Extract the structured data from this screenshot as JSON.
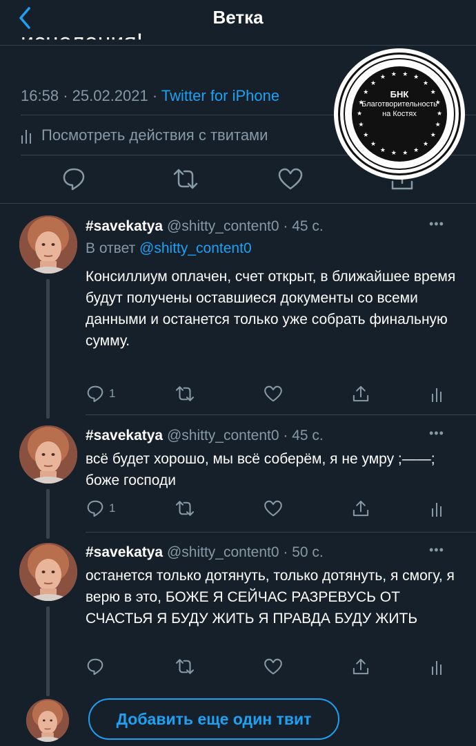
{
  "header": {
    "title": "Ветка",
    "cut_text": "исцеления!"
  },
  "main_tweet": {
    "time": "16:58",
    "date": "25.02.2021",
    "source": "Twitter for iPhone",
    "activity_label": "Посмотреть действия с твитами"
  },
  "stamp": {
    "line1": "БНК",
    "line2": "Благотворительность",
    "line3": "на Костях"
  },
  "replies": [
    {
      "name": "#savekatya",
      "handle": "@shitty_content0",
      "time": "45 с.",
      "reply_prefix": "В ответ",
      "reply_to": "@shitty_content0",
      "text": "Консиллиум оплачен, счет открыт, в ближайшее время будут получены оставшиеся документы со всеми данными и останется только уже собрать финальную сумму.",
      "reply_count": "1"
    },
    {
      "name": "#savekatya",
      "handle": "@shitty_content0",
      "time": "45 с.",
      "text": "всё будет хорошо, мы всё соберём, я не умру ;——; боже господи",
      "reply_count": "1"
    },
    {
      "name": "#savekatya",
      "handle": "@shitty_content0",
      "time": "50 с.",
      "text": "останется только дотянуть, только дотянуть, я смогу, я верю в это, БОЖЕ Я СЕЙЧАС РАЗРЕВУСЬ ОТ СЧАСТЬЯ Я БУДУ ЖИТЬ Я ПРАВДА БУДУ ЖИТЬ",
      "reply_count": ""
    }
  ],
  "add_tweet_label": "Добавить еще один твит",
  "colors": {
    "background": "#15202b",
    "accent": "#1da1f2",
    "muted": "#8899a6",
    "divider": "#38444d"
  }
}
